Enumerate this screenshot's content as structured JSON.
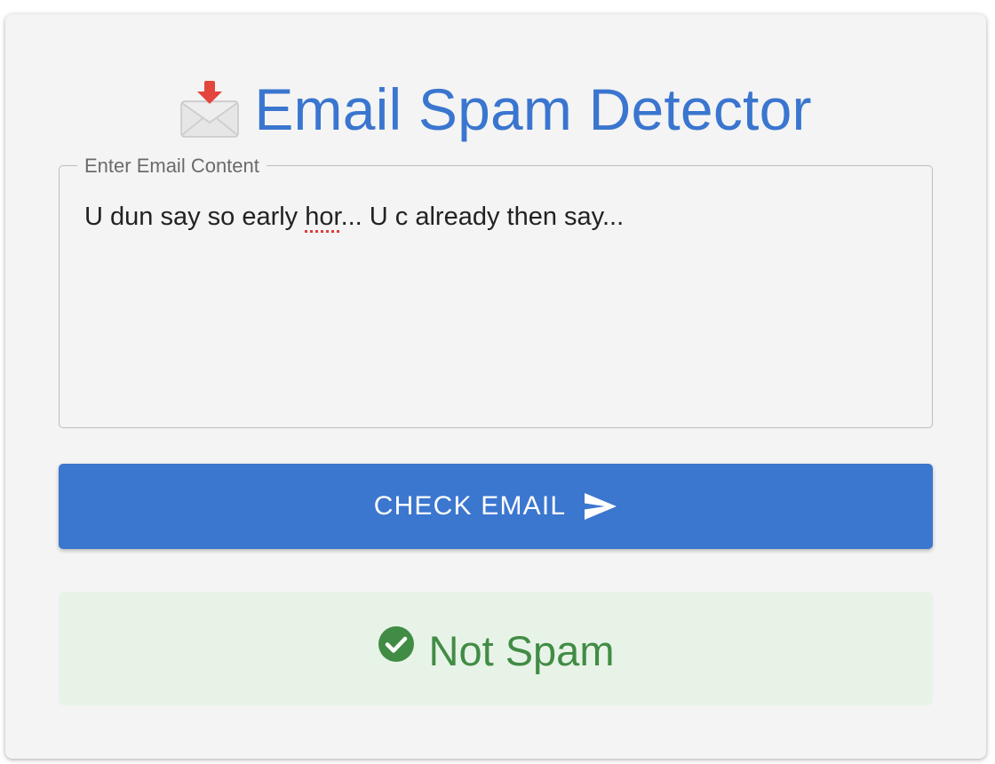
{
  "app": {
    "title": "Email Spam Detector",
    "title_icon": "envelope-with-arrow-icon"
  },
  "email_field": {
    "label": "Enter Email Content",
    "value_before": "U dun say so early ",
    "misspelled_word": "hor",
    "value_after": "... U c already then say..."
  },
  "check_button": {
    "label": "CHECK EMAIL",
    "icon": "send-icon"
  },
  "result": {
    "label": "Not Spam",
    "icon": "check-circle-icon"
  },
  "colors": {
    "accent": "#3b76cf",
    "success_text": "#418c45",
    "success_bg": "#e8f3e8",
    "card_bg": "#f4f4f4"
  }
}
